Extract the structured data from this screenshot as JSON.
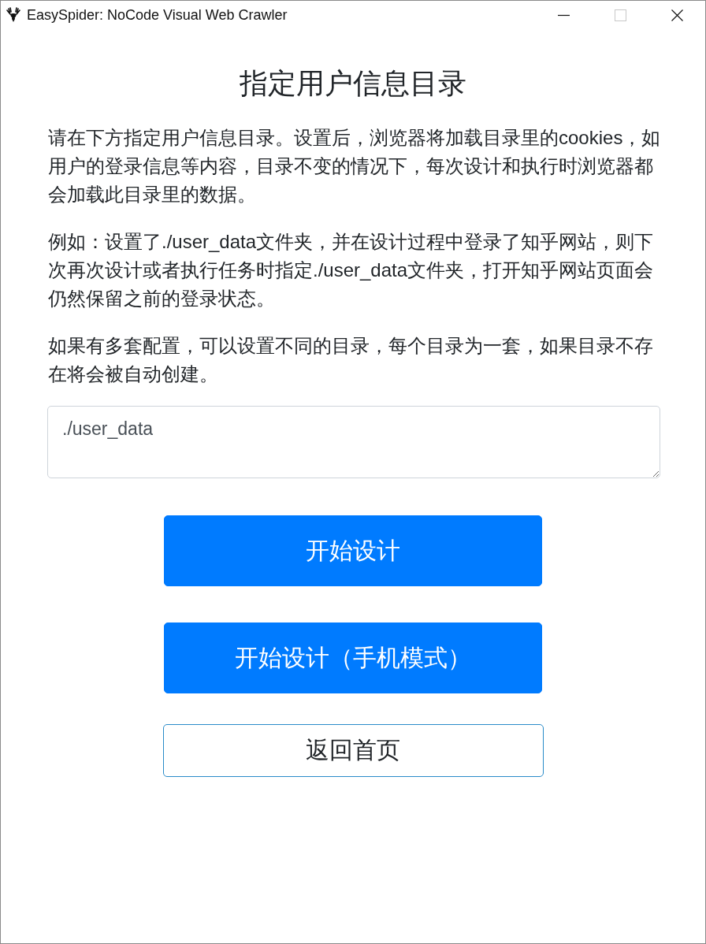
{
  "window": {
    "title": "EasySpider: NoCode Visual Web Crawler",
    "controls": [
      {
        "kind": "minimize",
        "disabled": false
      },
      {
        "kind": "maximize",
        "disabled": true
      },
      {
        "kind": "close",
        "disabled": false
      }
    ]
  },
  "heading": "指定用户信息目录",
  "paragraphs": [
    "请在下方指定用户信息目录。设置后，浏览器将加载目录里的cookies，如用户的登录信息等内容，目录不变的情况下，每次设计和执行时浏览器都会加载此目录里的数据。",
    "例如：设置了./user_data文件夹，并在设计过程中登录了知乎网站，则下次再次设计或者执行任务时指定./user_data文件夹，打开知乎网站页面会仍然保留之前的登录状态。",
    "如果有多套配置，可以设置不同的目录，每个目录为一套，如果目录不存在将会被自动创建。"
  ],
  "directory_field": {
    "value": "./user_data"
  },
  "buttons": [
    {
      "label": "开始设计",
      "kind": "primary"
    },
    {
      "label": "开始设计（手机模式）",
      "kind": "primary"
    },
    {
      "label": "返回首页",
      "kind": "outline"
    }
  ]
}
